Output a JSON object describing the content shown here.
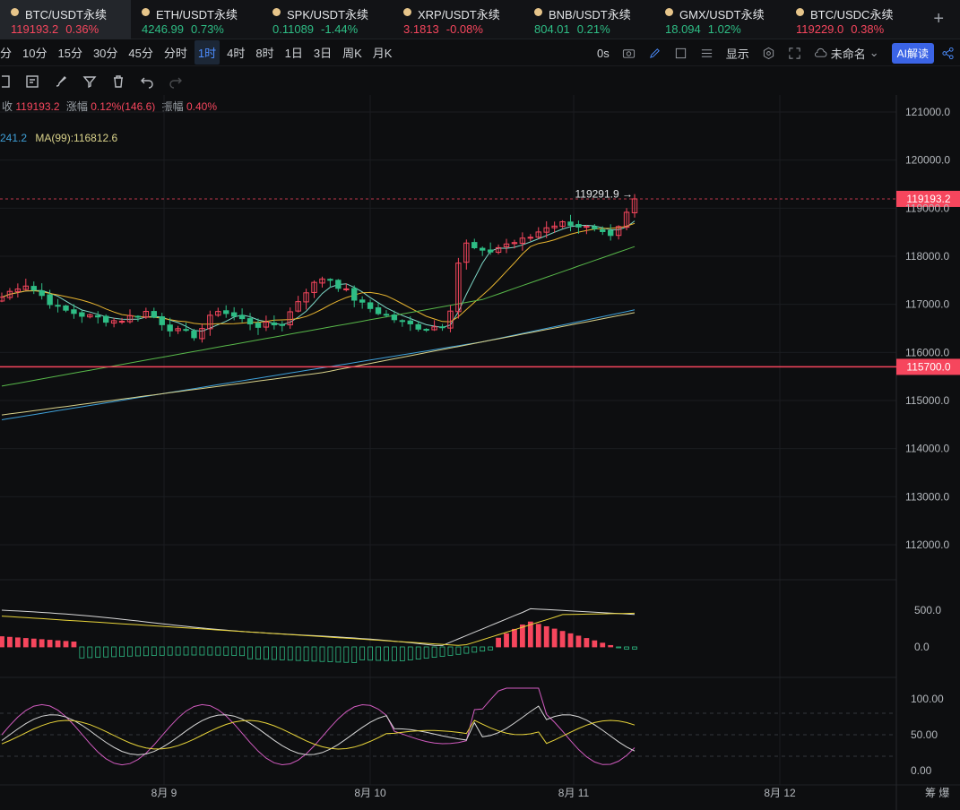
{
  "tabs": [
    {
      "symbol": "BTC/USDT永续",
      "price": "119193.2",
      "change": "0.36%",
      "dir": "down",
      "active": true
    },
    {
      "symbol": "ETH/USDT永续",
      "price": "4246.99",
      "change": "0.73%",
      "dir": "up"
    },
    {
      "symbol": "SPK/USDT永续",
      "price": "0.11089",
      "change": "-1.44%",
      "dir": "up"
    },
    {
      "symbol": "XRP/USDT永续",
      "price": "3.1813",
      "change": "-0.08%",
      "dir": "down"
    },
    {
      "symbol": "BNB/USDT永续",
      "price": "804.01",
      "change": "0.21%",
      "dir": "up"
    },
    {
      "symbol": "GMX/USDT永续",
      "price": "18.094",
      "change": "1.02%",
      "dir": "up"
    },
    {
      "symbol": "BTC/USDC永续",
      "price": "119229.0",
      "change": "0.38%",
      "dir": "down"
    }
  ],
  "add_tab": "+",
  "intervals": [
    "分",
    "10分",
    "15分",
    "30分",
    "45分",
    "分时",
    "1时",
    "4时",
    "8时",
    "1日",
    "3日",
    "周K",
    "月K"
  ],
  "active_interval": "1时",
  "toolbar_right": {
    "latency": "0s",
    "display": "显示",
    "layout_name": "未命名",
    "ai": "AI解读"
  },
  "legend": {
    "close_label": "收",
    "close_value": "119193.2",
    "change_label": "涨幅",
    "change_value": "0.12%(146.6)",
    "amp_label": "振幅",
    "amp_value": "0.40%",
    "ma_prefix": "241.2",
    "ma99_label": "MA(99):116812.6"
  },
  "colors": {
    "up": "#2ebd85",
    "down": "#f6465d",
    "ma5": "#7fd9c8",
    "ma10": "#e8b530",
    "ma30": "#58b84a",
    "ma60": "#3fa0d8",
    "ma99": "#d9d28a",
    "price_line": "#f6465d",
    "accent": "#3b64e6"
  },
  "chart_data": {
    "type": "candlestick",
    "price_axis": {
      "ticks": [
        "121000.0",
        "120000.0",
        "119000.0",
        "118000.0",
        "117000.0",
        "116000.0",
        "115000.0",
        "114000.0",
        "113000.0",
        "112000.0"
      ],
      "range": [
        111500,
        121400
      ]
    },
    "current_price": 119193.2,
    "current_price_label": "119193.2",
    "alert_price": 115700,
    "alert_price_label": "115700.0",
    "high_marker": "119291.9 →",
    "date_ticks": [
      "8月 9",
      "8月 10",
      "8月 11",
      "8月 12"
    ],
    "corner_label": "筹 爆",
    "macd_axis": [
      "500.0",
      "0.0"
    ],
    "kdj_axis": [
      "100.00",
      "50.00",
      "0.00"
    ]
  }
}
